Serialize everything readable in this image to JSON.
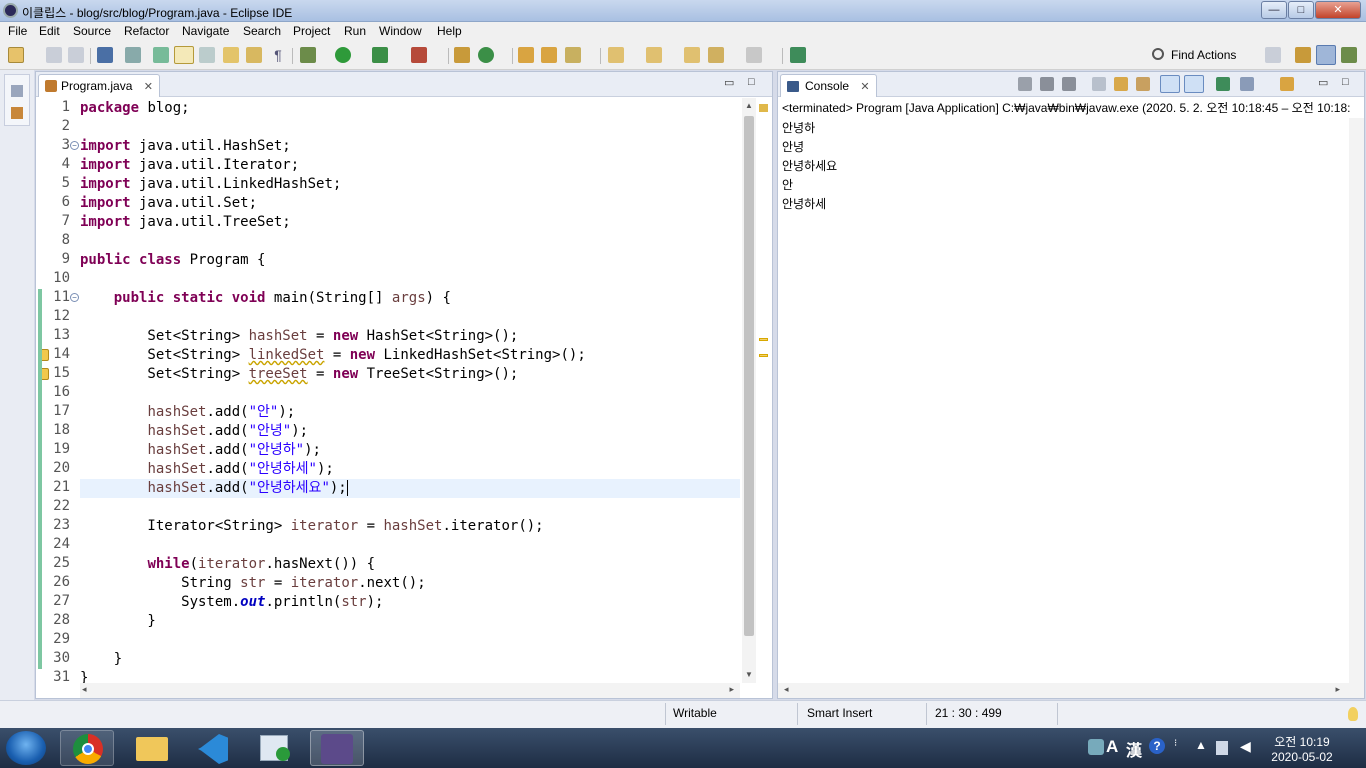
{
  "window": {
    "title": "이클립스 - blog/src/blog/Program.java - Eclipse IDE",
    "minimize": "—",
    "maximize": "□",
    "close": "✕"
  },
  "menu": [
    "File",
    "Edit",
    "Source",
    "Refactor",
    "Navigate",
    "Search",
    "Project",
    "Run",
    "Window",
    "Help"
  ],
  "toolbar": {
    "find_actions": "Find Actions"
  },
  "editor": {
    "tab_label": "Program.java",
    "tab_close": "✕",
    "minimize": "▭",
    "maximize": "□",
    "lines": [
      {
        "n": "1",
        "t": "package blog;"
      },
      {
        "n": "2",
        "t": ""
      },
      {
        "n": "3",
        "t": "import java.util.HashSet;",
        "fold": true
      },
      {
        "n": "4",
        "t": "import java.util.Iterator;"
      },
      {
        "n": "5",
        "t": "import java.util.LinkedHashSet;"
      },
      {
        "n": "6",
        "t": "import java.util.Set;"
      },
      {
        "n": "7",
        "t": "import java.util.TreeSet;"
      },
      {
        "n": "8",
        "t": ""
      },
      {
        "n": "9",
        "t": "public class Program {"
      },
      {
        "n": "10",
        "t": ""
      },
      {
        "n": "11",
        "t": "    public static void main(String[] args) {",
        "fold": true
      },
      {
        "n": "12",
        "t": ""
      },
      {
        "n": "13",
        "t": "        Set<String> hashSet = new HashSet<String>();"
      },
      {
        "n": "14",
        "t": "        Set<String> linkedSet = new LinkedHashSet<String>();",
        "warning": true
      },
      {
        "n": "15",
        "t": "        Set<String> treeSet = new TreeSet<String>();",
        "warning": true
      },
      {
        "n": "16",
        "t": ""
      },
      {
        "n": "17",
        "t": "        hashSet.add(\"안\");"
      },
      {
        "n": "18",
        "t": "        hashSet.add(\"안녕\");"
      },
      {
        "n": "19",
        "t": "        hashSet.add(\"안녕하\");"
      },
      {
        "n": "20",
        "t": "        hashSet.add(\"안녕하세\");"
      },
      {
        "n": "21",
        "t": "        hashSet.add(\"안녕하세요\");",
        "current": true
      },
      {
        "n": "22",
        "t": ""
      },
      {
        "n": "23",
        "t": "        Iterator<String> iterator = hashSet.iterator();"
      },
      {
        "n": "24",
        "t": ""
      },
      {
        "n": "25",
        "t": "        while(iterator.hasNext()) {"
      },
      {
        "n": "26",
        "t": "            String str = iterator.next();"
      },
      {
        "n": "27",
        "t": "            System.out.println(str);"
      },
      {
        "n": "28",
        "t": "        }"
      },
      {
        "n": "29",
        "t": ""
      },
      {
        "n": "30",
        "t": "    }"
      },
      {
        "n": "31",
        "t": "}"
      }
    ]
  },
  "console": {
    "tab_label": "Console",
    "tab_close": "✕",
    "description": "<terminated> Program [Java Application] C:₩java₩bin₩javaw.exe  (2020. 5. 2. 오전 10:18:45 – 오전 10:18:",
    "output": [
      "안녕하",
      "안녕",
      "안녕하세요",
      "안",
      "안녕하세"
    ]
  },
  "status": {
    "writable": "Writable",
    "insert_mode": "Smart Insert",
    "position": "21 : 30 : 499"
  },
  "taskbar": {
    "apps": [
      "chrome-icon",
      "file-explorer-icon",
      "vscode-icon",
      "media-player-icon",
      "eclipse-icon"
    ],
    "tray": {
      "ime_a": "A",
      "ime_han": "漢",
      "help": "?"
    },
    "time": "오전 10:19",
    "date": "2020-05-02"
  },
  "colors": {
    "keyword": "#7f0055",
    "string": "#2a00ff",
    "variable": "#6a3e3e",
    "static_field": "#0000c0",
    "current_line": "#e8f2fe"
  }
}
